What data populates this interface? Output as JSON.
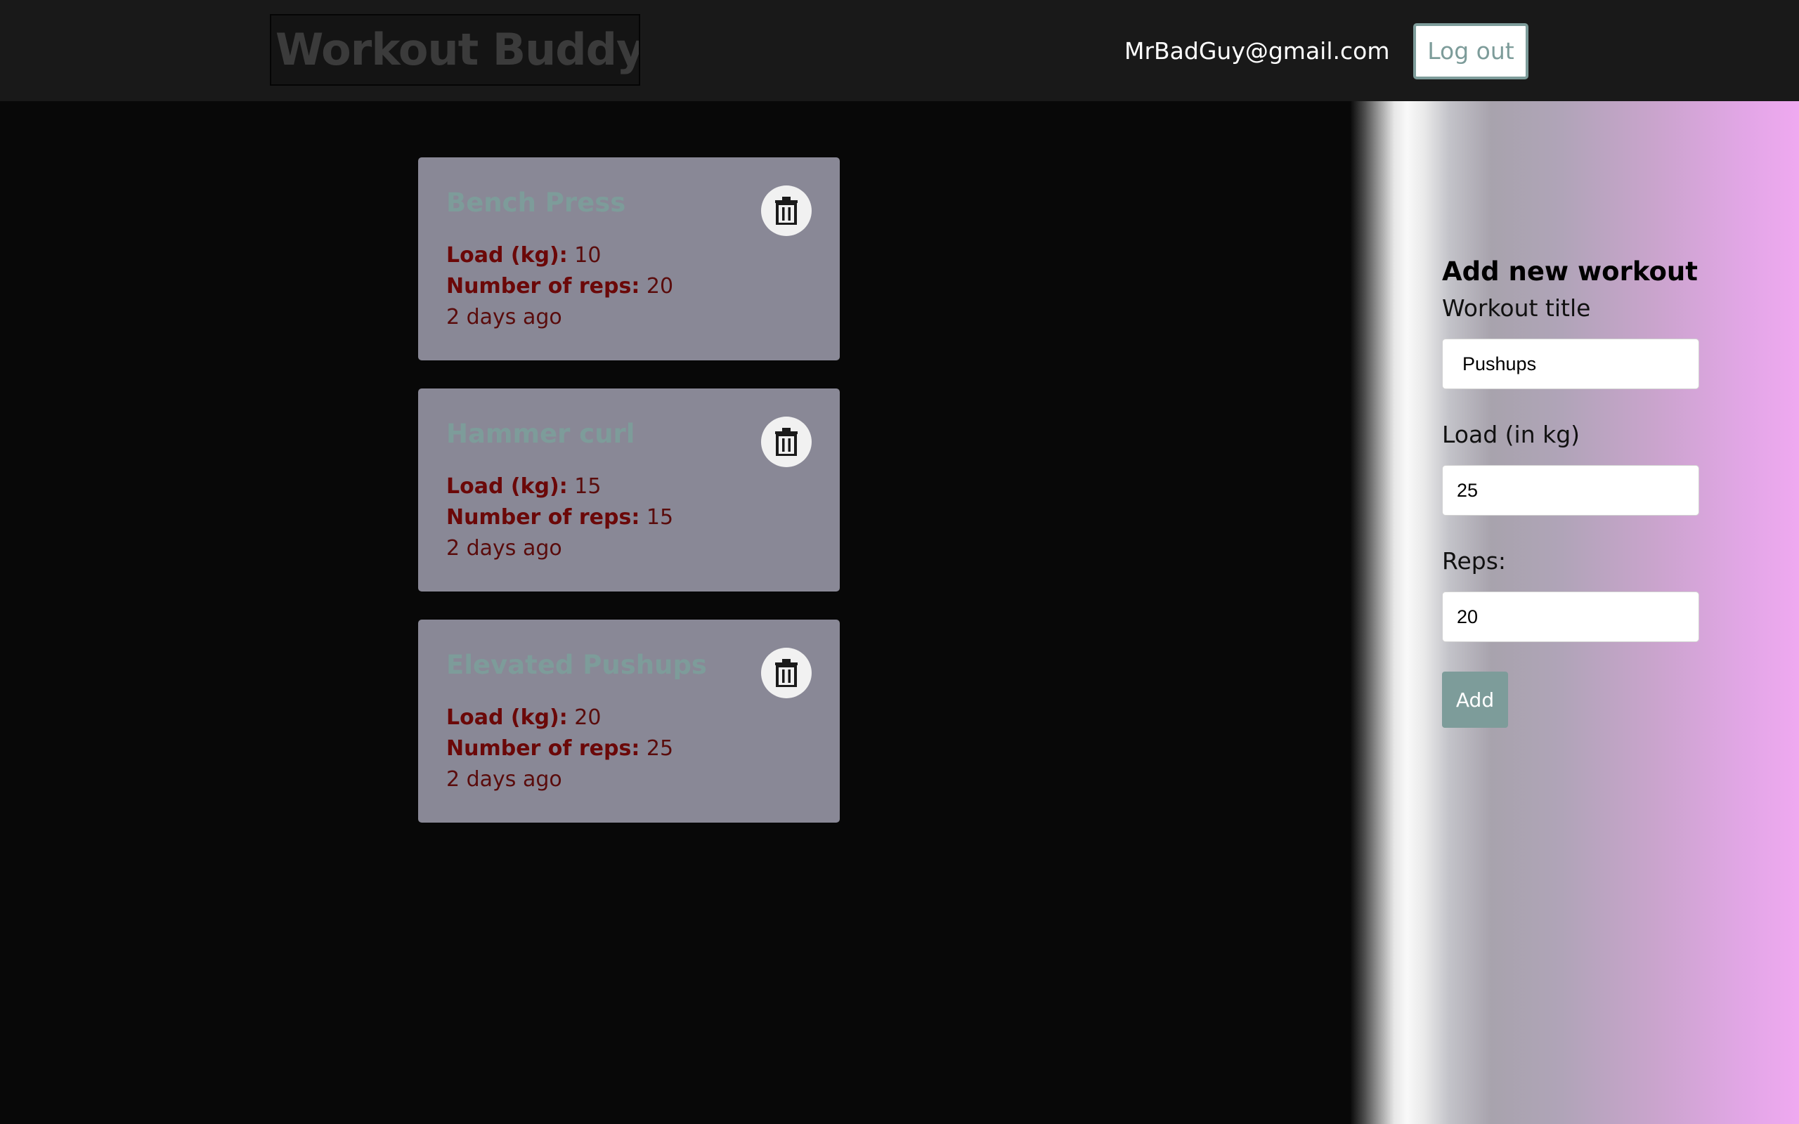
{
  "header": {
    "logo": "Workout Buddy",
    "user_email": "MrBadGuy@gmail.com",
    "logout_label": "Log out"
  },
  "workouts": [
    {
      "title": "Bench Press",
      "load_label": "Load (kg):",
      "load": "10",
      "reps_label": "Number of reps:",
      "reps": "20",
      "time": "2 days ago"
    },
    {
      "title": "Hammer curl",
      "load_label": "Load (kg):",
      "load": "15",
      "reps_label": "Number of reps:",
      "reps": "15",
      "time": "2 days ago"
    },
    {
      "title": "Elevated Pushups",
      "load_label": "Load (kg):",
      "load": "20",
      "reps_label": "Number of reps:",
      "reps": "25",
      "time": "2 days ago"
    }
  ],
  "form": {
    "heading": "Add new workout",
    "title_label": "Workout title",
    "title_value": "Pushups",
    "load_label": "Load (in kg)",
    "load_value": "25",
    "reps_label": "Reps:",
    "reps_value": "20",
    "add_label": "Add"
  },
  "icons": {
    "delete": "trash-icon"
  },
  "colors": {
    "accent": "#7d9c9a",
    "card_bg": "#898896",
    "label_red": "#6b0808",
    "navbar_bg": "#191919",
    "page_bg": "#080808"
  }
}
